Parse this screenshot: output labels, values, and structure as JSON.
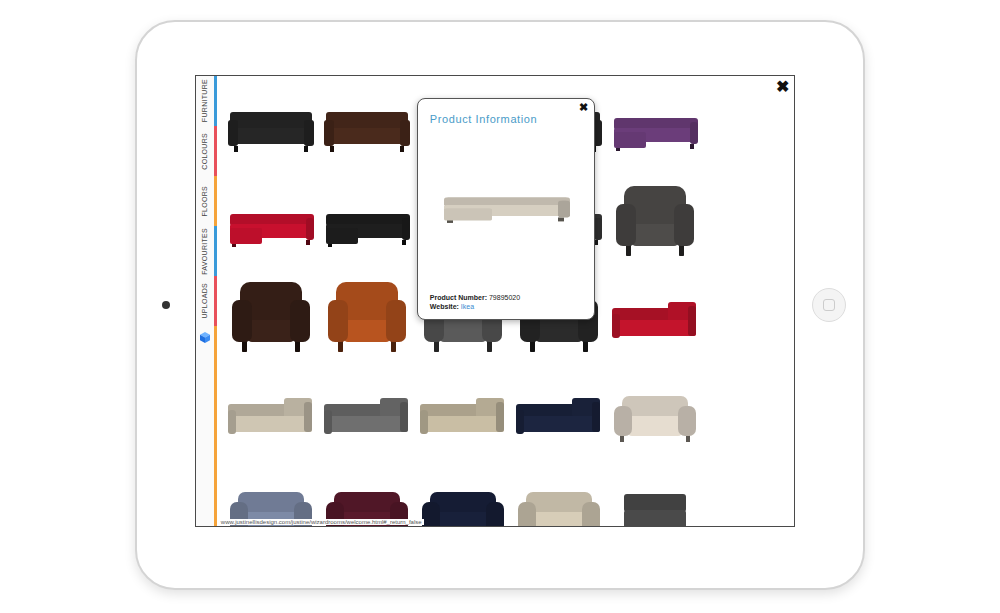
{
  "screen": {
    "close": "✖",
    "status_url": "www.justinellisdesign.com/justine/wizardrooms/welcome.html#_return_false"
  },
  "sidebar": {
    "tabs": [
      {
        "label": "FURNITURE",
        "color": "#3a9ad9"
      },
      {
        "label": "COLOURS",
        "color": "#e8505b"
      },
      {
        "label": "FLOORS",
        "color": "#f5a33a"
      },
      {
        "label": "FAVOURITES",
        "color": "#3a9ad9"
      },
      {
        "label": "UPLOADS",
        "color": "#e8505b"
      }
    ]
  },
  "products": [
    {
      "kind": "sofa",
      "color": "#262626"
    },
    {
      "kind": "sofa",
      "color": "#4a2a1c"
    },
    {
      "kind": "sofa",
      "color": "#d8d2c6"
    },
    {
      "kind": "sofa",
      "color": "#2a2a2a"
    },
    {
      "kind": "chaise",
      "color": "#6b3d7a"
    },
    {
      "kind": "chaise",
      "color": "#c8102e"
    },
    {
      "kind": "chaise",
      "color": "#1e1e1e"
    },
    {
      "kind": "chaise",
      "color": "#8a8a8a"
    },
    {
      "kind": "chaise",
      "color": "#3a3a3a"
    },
    {
      "kind": "armchair",
      "color": "#4e4c4a"
    },
    {
      "kind": "armchair",
      "color": "#3a2219"
    },
    {
      "kind": "armchair",
      "color": "#b8541f"
    },
    {
      "kind": "armchair",
      "color": "#5a5a5a"
    },
    {
      "kind": "armchair",
      "color": "#2b2b2b"
    },
    {
      "kind": "corner",
      "color": "#c4142c"
    },
    {
      "kind": "corner",
      "color": "#cfc6b3"
    },
    {
      "kind": "corner",
      "color": "#6f6f6f"
    },
    {
      "kind": "corner",
      "color": "#c9bea4"
    },
    {
      "kind": "corner",
      "color": "#1c2540"
    },
    {
      "kind": "loveseat",
      "color": "#e6ddd0"
    },
    {
      "kind": "loveseat",
      "color": "#7d8aa6"
    },
    {
      "kind": "loveseat",
      "color": "#5a1a2c"
    },
    {
      "kind": "loveseat",
      "color": "#18203a"
    },
    {
      "kind": "loveseat",
      "color": "#d7cdb8"
    },
    {
      "kind": "module",
      "color": "#4a4a4a"
    }
  ],
  "popup": {
    "title": "Product Information",
    "close": "✖",
    "product": {
      "kind": "chaise",
      "color": "#d6cfc1"
    },
    "fields": [
      {
        "label": "Product Number:",
        "value": "79895020",
        "link": false
      },
      {
        "label": "Website:",
        "value": "Ikea",
        "link": true
      }
    ]
  }
}
